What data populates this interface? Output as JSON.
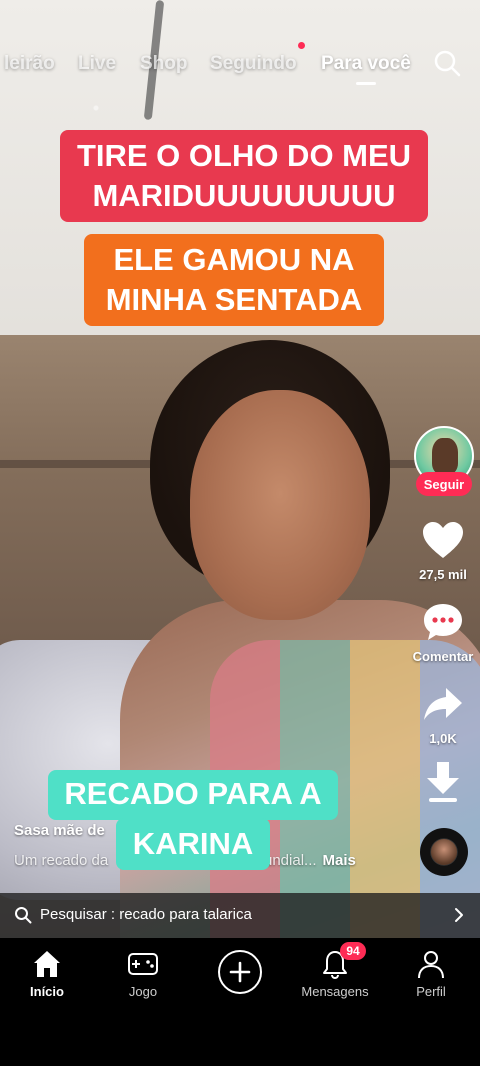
{
  "top_nav": {
    "tabs": [
      {
        "label": "leirão"
      },
      {
        "label": "Live"
      },
      {
        "label": "Shop"
      },
      {
        "label": "Seguindo"
      },
      {
        "label": "Para você"
      }
    ],
    "active_tab": "Para você"
  },
  "captions": {
    "line1": "TIRE O OLHO DO MEU MARIDUUUUUUUUU",
    "line2": "ELE GAMOU NA MINHA SENTADA",
    "line3": "RECADO PARA A",
    "line4": "KARINA"
  },
  "sidebar": {
    "follow_label": "Seguir",
    "likes": "27,5 mil",
    "comments_label": "Comentar",
    "shares": "1,0K"
  },
  "post": {
    "author": "Sasa mãe de",
    "description_start": "Um recado da",
    "description_end": "undial...",
    "more_label": "Mais"
  },
  "search_bar": {
    "text": "Pesquisar : recado para talarica"
  },
  "bottom_nav": {
    "home": "Início",
    "games": "Jogo",
    "messages": "Mensagens",
    "messages_badge": "94",
    "profile": "Perfil"
  },
  "colors": {
    "accent": "#fe2c55",
    "caption_red": "#e8394f",
    "caption_orange": "#f26f1d",
    "caption_teal": "#4fe0c7"
  }
}
